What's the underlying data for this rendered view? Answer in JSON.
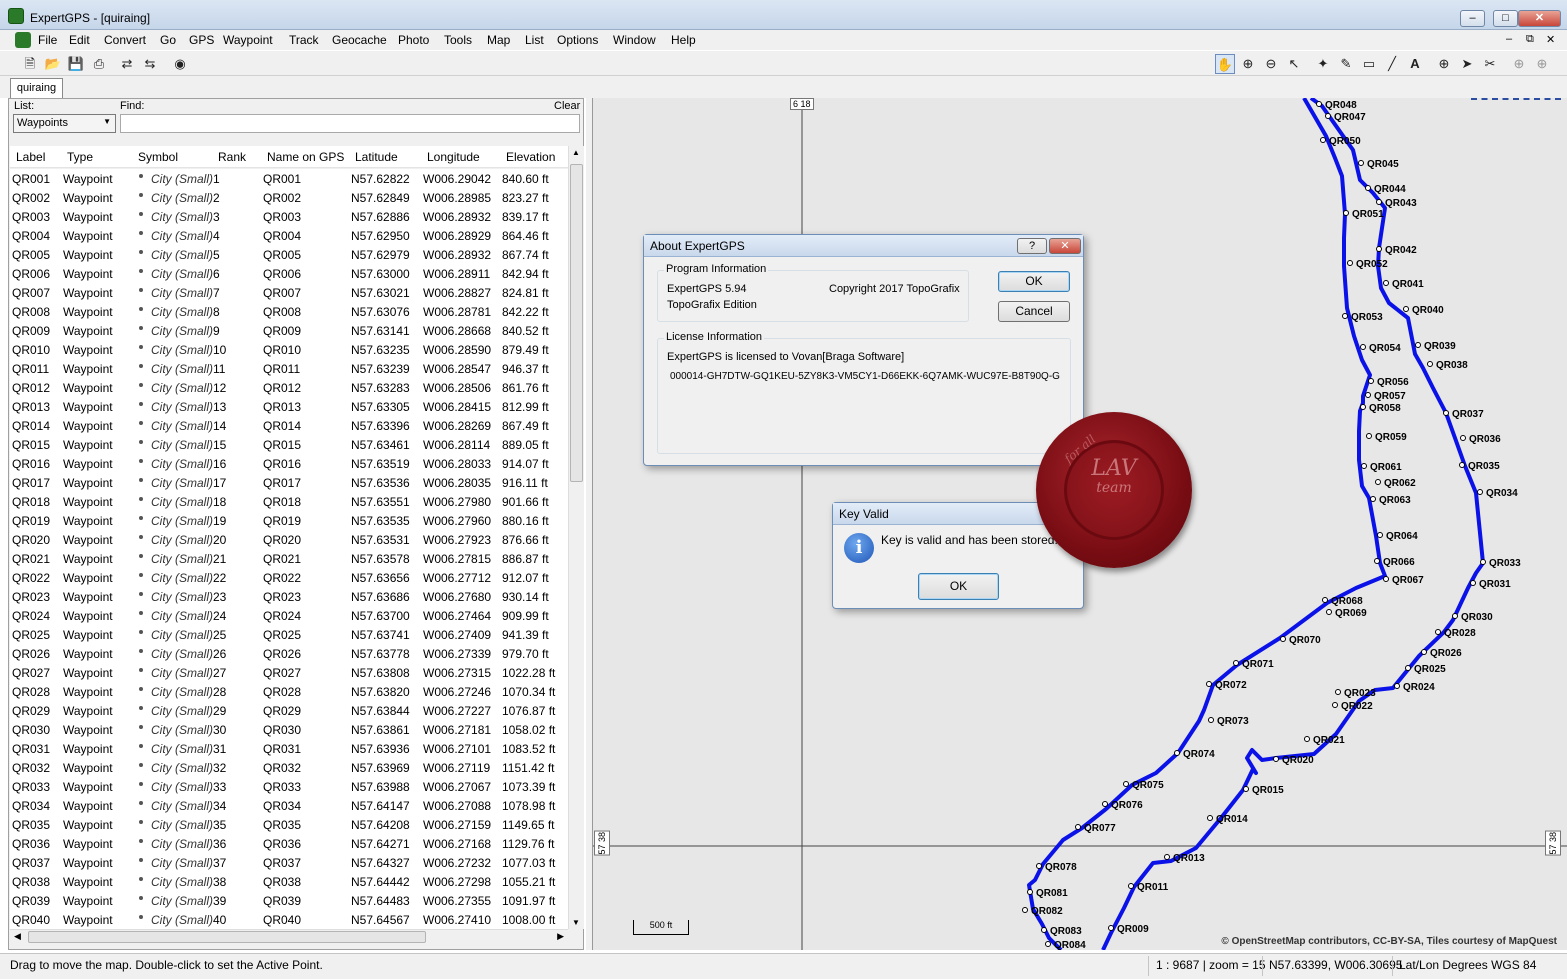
{
  "window": {
    "title": "ExpertGPS - [quiraing]"
  },
  "menu": [
    "File",
    "Edit",
    "Convert",
    "Go",
    "GPS",
    "Waypoint",
    "Track",
    "Geocache",
    "Photo",
    "Tools",
    "Map",
    "List",
    "Options",
    "Window",
    "Help"
  ],
  "tab": "quiraing",
  "panel": {
    "list_label": "List:",
    "list_value": "Waypoints",
    "find_label": "Find:",
    "clear_label": "Clear"
  },
  "columns": [
    "Label",
    "Type",
    "Symbol",
    "Rank",
    "Name on GPS",
    "Latitude",
    "Longitude",
    "Elevation"
  ],
  "rows": [
    [
      "QR001",
      "Waypoint",
      "City (Small)",
      "1",
      "QR001",
      "N57.62822",
      "W006.29042",
      "840.60 ft"
    ],
    [
      "QR002",
      "Waypoint",
      "City (Small)",
      "2",
      "QR002",
      "N57.62849",
      "W006.28985",
      "823.27 ft"
    ],
    [
      "QR003",
      "Waypoint",
      "City (Small)",
      "3",
      "QR003",
      "N57.62886",
      "W006.28932",
      "839.17 ft"
    ],
    [
      "QR004",
      "Waypoint",
      "City (Small)",
      "4",
      "QR004",
      "N57.62950",
      "W006.28929",
      "864.46 ft"
    ],
    [
      "QR005",
      "Waypoint",
      "City (Small)",
      "5",
      "QR005",
      "N57.62979",
      "W006.28932",
      "867.74 ft"
    ],
    [
      "QR006",
      "Waypoint",
      "City (Small)",
      "6",
      "QR006",
      "N57.63000",
      "W006.28911",
      "842.94 ft"
    ],
    [
      "QR007",
      "Waypoint",
      "City (Small)",
      "7",
      "QR007",
      "N57.63021",
      "W006.28827",
      "824.81 ft"
    ],
    [
      "QR008",
      "Waypoint",
      "City (Small)",
      "8",
      "QR008",
      "N57.63076",
      "W006.28781",
      "842.22 ft"
    ],
    [
      "QR009",
      "Waypoint",
      "City (Small)",
      "9",
      "QR009",
      "N57.63141",
      "W006.28668",
      "840.52 ft"
    ],
    [
      "QR010",
      "Waypoint",
      "City (Small)",
      "10",
      "QR010",
      "N57.63235",
      "W006.28590",
      "879.49 ft"
    ],
    [
      "QR011",
      "Waypoint",
      "City (Small)",
      "11",
      "QR011",
      "N57.63239",
      "W006.28547",
      "946.37 ft"
    ],
    [
      "QR012",
      "Waypoint",
      "City (Small)",
      "12",
      "QR012",
      "N57.63283",
      "W006.28506",
      "861.76 ft"
    ],
    [
      "QR013",
      "Waypoint",
      "City (Small)",
      "13",
      "QR013",
      "N57.63305",
      "W006.28415",
      "812.99 ft"
    ],
    [
      "QR014",
      "Waypoint",
      "City (Small)",
      "14",
      "QR014",
      "N57.63396",
      "W006.28269",
      "867.49 ft"
    ],
    [
      "QR015",
      "Waypoint",
      "City (Small)",
      "15",
      "QR015",
      "N57.63461",
      "W006.28114",
      "889.05 ft"
    ],
    [
      "QR016",
      "Waypoint",
      "City (Small)",
      "16",
      "QR016",
      "N57.63519",
      "W006.28033",
      "914.07 ft"
    ],
    [
      "QR017",
      "Waypoint",
      "City (Small)",
      "17",
      "QR017",
      "N57.63536",
      "W006.28035",
      "916.11 ft"
    ],
    [
      "QR018",
      "Waypoint",
      "City (Small)",
      "18",
      "QR018",
      "N57.63551",
      "W006.27980",
      "901.66 ft"
    ],
    [
      "QR019",
      "Waypoint",
      "City (Small)",
      "19",
      "QR019",
      "N57.63535",
      "W006.27960",
      "880.16 ft"
    ],
    [
      "QR020",
      "Waypoint",
      "City (Small)",
      "20",
      "QR020",
      "N57.63531",
      "W006.27923",
      "876.66 ft"
    ],
    [
      "QR021",
      "Waypoint",
      "City (Small)",
      "21",
      "QR021",
      "N57.63578",
      "W006.27815",
      "886.87 ft"
    ],
    [
      "QR022",
      "Waypoint",
      "City (Small)",
      "22",
      "QR022",
      "N57.63656",
      "W006.27712",
      "912.07 ft"
    ],
    [
      "QR023",
      "Waypoint",
      "City (Small)",
      "23",
      "QR023",
      "N57.63686",
      "W006.27680",
      "930.14 ft"
    ],
    [
      "QR024",
      "Waypoint",
      "City (Small)",
      "24",
      "QR024",
      "N57.63700",
      "W006.27464",
      "909.99 ft"
    ],
    [
      "QR025",
      "Waypoint",
      "City (Small)",
      "25",
      "QR025",
      "N57.63741",
      "W006.27409",
      "941.39 ft"
    ],
    [
      "QR026",
      "Waypoint",
      "City (Small)",
      "26",
      "QR026",
      "N57.63778",
      "W006.27339",
      "979.70 ft"
    ],
    [
      "QR027",
      "Waypoint",
      "City (Small)",
      "27",
      "QR027",
      "N57.63808",
      "W006.27315",
      "1022.28 ft"
    ],
    [
      "QR028",
      "Waypoint",
      "City (Small)",
      "28",
      "QR028",
      "N57.63820",
      "W006.27246",
      "1070.34 ft"
    ],
    [
      "QR029",
      "Waypoint",
      "City (Small)",
      "29",
      "QR029",
      "N57.63844",
      "W006.27227",
      "1076.87 ft"
    ],
    [
      "QR030",
      "Waypoint",
      "City (Small)",
      "30",
      "QR030",
      "N57.63861",
      "W006.27181",
      "1058.02 ft"
    ],
    [
      "QR031",
      "Waypoint",
      "City (Small)",
      "31",
      "QR031",
      "N57.63936",
      "W006.27101",
      "1083.52 ft"
    ],
    [
      "QR032",
      "Waypoint",
      "City (Small)",
      "32",
      "QR032",
      "N57.63969",
      "W006.27119",
      "1151.42 ft"
    ],
    [
      "QR033",
      "Waypoint",
      "City (Small)",
      "33",
      "QR033",
      "N57.63988",
      "W006.27067",
      "1073.39 ft"
    ],
    [
      "QR034",
      "Waypoint",
      "City (Small)",
      "34",
      "QR034",
      "N57.64147",
      "W006.27088",
      "1078.98 ft"
    ],
    [
      "QR035",
      "Waypoint",
      "City (Small)",
      "35",
      "QR035",
      "N57.64208",
      "W006.27159",
      "1149.65 ft"
    ],
    [
      "QR036",
      "Waypoint",
      "City (Small)",
      "36",
      "QR036",
      "N57.64271",
      "W006.27168",
      "1129.76 ft"
    ],
    [
      "QR037",
      "Waypoint",
      "City (Small)",
      "37",
      "QR037",
      "N57.64327",
      "W006.27232",
      "1077.03 ft"
    ],
    [
      "QR038",
      "Waypoint",
      "City (Small)",
      "38",
      "QR038",
      "N57.64442",
      "W006.27298",
      "1055.21 ft"
    ],
    [
      "QR039",
      "Waypoint",
      "City (Small)",
      "39",
      "QR039",
      "N57.64483",
      "W006.27355",
      "1091.97 ft"
    ],
    [
      "QR040",
      "Waypoint",
      "City (Small)",
      "40",
      "QR040",
      "N57.64567",
      "W006.27410",
      "1008.00 ft"
    ]
  ],
  "map": {
    "grid_top_label": "6 18",
    "grid_left_label": "57 38",
    "grid_right_label": "57 38",
    "scale_label": "500 ft",
    "copyright": "© OpenStreetMap contributors, CC-BY-SA, Tiles courtesy of MapQuest",
    "track_color": "#0b12e8",
    "waypoint_labels": [
      "QR048",
      "QR047",
      "QR050",
      "QR045",
      "QR044",
      "QR043",
      "QR051",
      "QR042",
      "QR052",
      "QR041",
      "QR040",
      "QR053",
      "QR039",
      "QR054",
      "QR038",
      "QR056",
      "QR057",
      "QR058",
      "QR037",
      "QR059",
      "QR036",
      "QR061",
      "QR035",
      "QR062",
      "QR063",
      "QR034",
      "QR064",
      "QR066",
      "QR033",
      "QR067",
      "QR031",
      "QR068",
      "QR069",
      "QR030",
      "QR028",
      "QR070",
      "QR026",
      "QR071",
      "QR025",
      "QR072",
      "QR024",
      "QR023",
      "QR022",
      "QR073",
      "QR021",
      "QR074",
      "QR020",
      "QR075",
      "QR015",
      "QR076",
      "QR014",
      "QR077",
      "QR013",
      "QR078",
      "QR011",
      "QR081",
      "QR082",
      "QR009",
      "QR083",
      "QR084"
    ]
  },
  "about_dialog": {
    "title": "About ExpertGPS",
    "help_btn": "?",
    "program_group": "Program Information",
    "version": "ExpertGPS 5.94",
    "copyright": "Copyright 2017 TopoGrafix",
    "edition": "TopoGrafix Edition",
    "license_group": "License Information",
    "licensed_to": "ExpertGPS is licensed to Vovan[Braga Software]",
    "key": "000014-GH7DTW-GQ1KEU-5ZY8K3-VM5CY1-D66EKK-6Q7AMK-WUC97E-B8T90Q-G",
    "ok": "OK",
    "cancel": "Cancel"
  },
  "key_dialog": {
    "title": "Key Valid",
    "message": "Key is valid and has been stored.",
    "ok": "OK"
  },
  "seal": {
    "line1": "LAV",
    "line2": "team",
    "arc": "for all"
  },
  "status": {
    "hint": "Drag to move the map.  Double-click to set the Active Point.",
    "scale": "1 : 9687 | zoom = 15",
    "coords": "N57.63399, W006.30695",
    "datum": "Lat/Lon Degrees WGS 84"
  }
}
